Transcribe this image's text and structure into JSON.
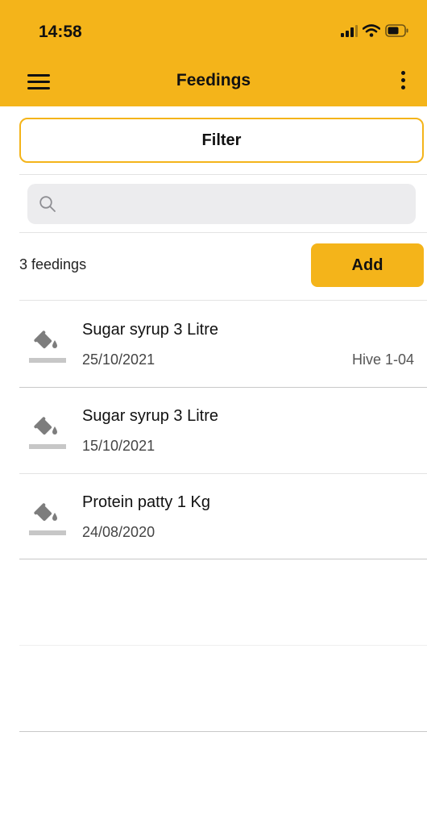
{
  "status_bar": {
    "time": "14:58"
  },
  "nav": {
    "title": "Feedings"
  },
  "filter": {
    "label": "Filter"
  },
  "search": {
    "placeholder": "",
    "value": ""
  },
  "list_header": {
    "count_label": "3 feedings",
    "add_label": "Add"
  },
  "feedings": [
    {
      "title": "Sugar syrup 3 Litre",
      "date": "25/10/2021",
      "hive": "Hive 1-04"
    },
    {
      "title": "Sugar syrup 3 Litre",
      "date": "15/10/2021",
      "hive": ""
    },
    {
      "title": "Protein patty 1 Kg",
      "date": "24/08/2020",
      "hive": ""
    }
  ],
  "theme": {
    "accent": "#f4b41a"
  },
  "icons": {
    "menu": "hamburger-menu-icon",
    "more": "more-vertical-icon",
    "search": "search-icon",
    "feeding": "paint-bucket-icon",
    "signal": "signal-icon",
    "wifi": "wifi-icon",
    "battery": "battery-icon"
  }
}
